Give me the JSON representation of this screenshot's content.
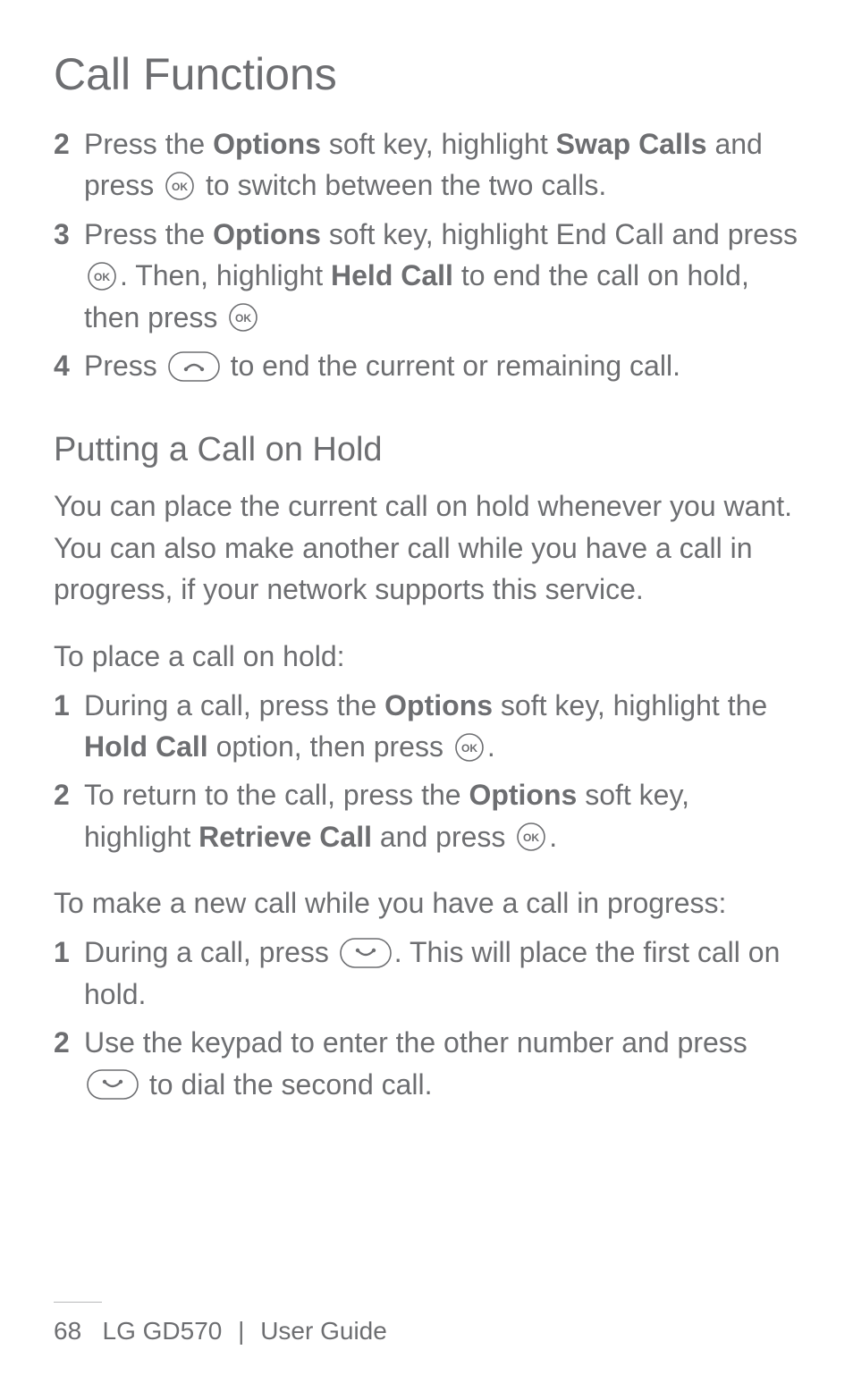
{
  "title": "Call Functions",
  "steps_a": [
    {
      "num": "2",
      "parts": [
        "Press the ",
        {
          "b": "Options"
        },
        " soft key, highlight ",
        {
          "b": "Swap Calls"
        },
        " and press ",
        {
          "icon": "ok"
        },
        " to switch between the two calls."
      ]
    },
    {
      "num": "3",
      "parts": [
        "Press the ",
        {
          "b": "Options"
        },
        " soft key, highlight End Call and press ",
        {
          "icon": "ok"
        },
        ". Then, highlight ",
        {
          "b": "Held Call"
        },
        " to end the call on hold, then press ",
        {
          "icon": "ok"
        }
      ]
    },
    {
      "num": "4",
      "parts": [
        "Press ",
        {
          "icon": "end"
        },
        " to end the current or remaining call."
      ]
    }
  ],
  "subhead": "Putting a Call on Hold",
  "para": "You can place the current call on hold whenever you want. You can also make another call while you have a call in progress, if your network supports this service.",
  "minihead_1": "To place a call on hold:",
  "steps_b": [
    {
      "num": "1",
      "parts": [
        "During a call, press the ",
        {
          "b": "Options"
        },
        " soft key, highlight the ",
        {
          "b": "Hold Call"
        },
        " option, then press ",
        {
          "icon": "ok"
        },
        "."
      ]
    },
    {
      "num": "2",
      "parts": [
        "To return to the call, press the ",
        {
          "b": "Options"
        },
        " soft key, highlight ",
        {
          "b": "Retrieve Call"
        },
        " and press ",
        {
          "icon": "ok"
        },
        "."
      ]
    }
  ],
  "minihead_2": "To make a new call while you have a call in progress:",
  "steps_c": [
    {
      "num": "1",
      "parts": [
        "During a call, press ",
        {
          "icon": "call"
        },
        ". This will place the first call on hold."
      ]
    },
    {
      "num": "2",
      "parts": [
        "Use the keypad to enter the other number and press ",
        {
          "icon": "call"
        },
        " to dial the second call."
      ]
    }
  ],
  "footer": {
    "page_num": "68",
    "model": "LG GD570",
    "divider": "|",
    "guide": "User Guide"
  }
}
